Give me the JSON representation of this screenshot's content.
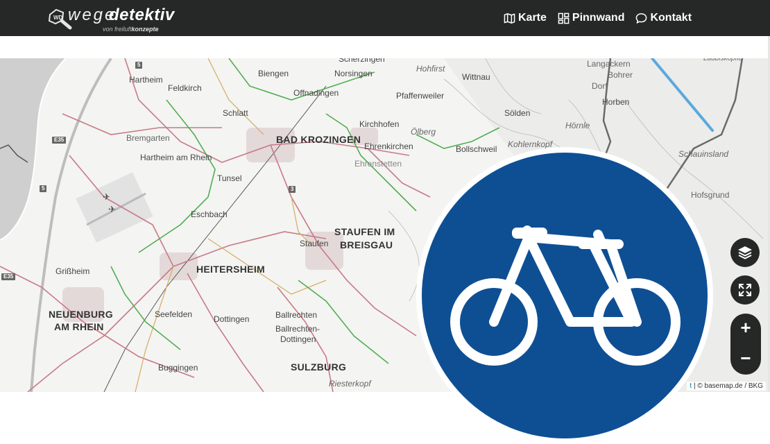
{
  "brand": {
    "wege": "wege",
    "detektiv": "detektiv",
    "sub_prefix": "von",
    "sub_light": "freiluft",
    "sub_bold": "konzepte"
  },
  "nav": {
    "items": [
      {
        "label": "Karte",
        "icon": "map-icon"
      },
      {
        "label": "Pinnwand",
        "icon": "dashboard-icon"
      },
      {
        "label": "Kontakt",
        "icon": "chat-bubble-icon"
      }
    ]
  },
  "map": {
    "places_big": [
      "BAD KROZINGEN",
      "STAUFEN IM",
      "BREISGAU",
      "HEITERSHEIM",
      "NEUENBURG",
      "AM RHEIN",
      "SULZBURG"
    ],
    "places": [
      "Hartheim",
      "Feldkirch",
      "Biengen",
      "Norsingen",
      "Offnadingen",
      "Schlatt",
      "Pfaffenweiler",
      "Wittnau",
      "Sölden",
      "Kirchhofen",
      "Ehrenkirchen",
      "Ehrenstetten",
      "Bollschweil",
      "Bremgarten",
      "Hartheim am Rhein",
      "Tunsel",
      "Eschbach",
      "Staufen",
      "Grißheim",
      "Seefelden",
      "Dottingen",
      "Ballrechten",
      "Ballrechten-",
      "Dottingen",
      "Buggingen",
      "Horben",
      "Langackern",
      "Bohrer",
      "Dorf",
      "Hofsgrund",
      "Scherzingen"
    ],
    "places_italic": [
      "Hohfirst",
      "Ölberg",
      "Kohlernkopf",
      "Hörnle",
      "Schauinsland",
      "Laubiskopfle",
      "Riesterkopf"
    ],
    "shields": [
      "5",
      "E35",
      "5",
      "3",
      "E35"
    ],
    "attribution_link": "t",
    "attribution_text": "| © basemap.de / BKG"
  },
  "controls": {
    "layers_icon": "layers-icon",
    "fullscreen_icon": "expand-icon",
    "zoom_in": "+",
    "zoom_out": "−"
  },
  "colors": {
    "topbar": "#262828",
    "sign_blue": "#0e4f94",
    "road_red": "#c77a86",
    "cycle_green": "#52ad52"
  }
}
